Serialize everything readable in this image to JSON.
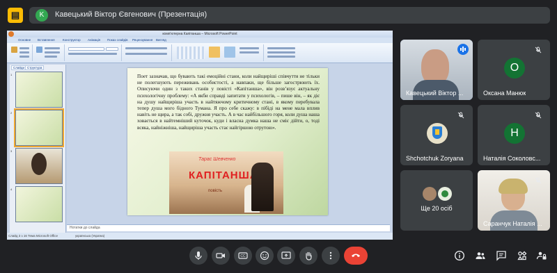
{
  "presentation_banner": {
    "avatar_letter": "K",
    "text": "Кавецький Віктор Євгенович (Презентація)"
  },
  "ppt": {
    "window_title": "комп'ютерна Капітанша – Microsoft PowerPoint",
    "tabs": [
      "Основне",
      "Вставлення",
      "Конструктор",
      "Анімація",
      "Показ слайдів",
      "Рецензування",
      "Вигляд"
    ],
    "panel_tabs": [
      "Слайди",
      "Структура"
    ],
    "slide_numbers": [
      "1",
      "2",
      "3",
      "4"
    ],
    "slide_text": "Поет зазначав, що бувають такі емоційні стани, коли найщиріші співчуття не тільки не полегшують переживань особистості, а навпаки, ще більше загострюють їх. Описуючи один з таких станів у повісті «Капітанша», він розв’язує актуальну психологічну проблему: «А якби справді запитати у психологів, – пише він, – як діє на душу найщиріша участь в найтяжчому критичному стані, в якому перебувала тепер душа мого бідного Туманa. Я про себе скажу: в пібіді на мене мала вплив навіть не щира, а так собі, дружня участь. А в час найбільшого горя, коли душа наша ховається в найтемніший куточок, куди і власна думка наша не сміє дійти, о, тоді всяка, найніжніша, найщиріша участь стає найгіршою отрутою».",
    "book_author": "Тарас Шевченко",
    "book_title": "КАПІТАНША",
    "book_subtitle": "повість",
    "notes_placeholder": "Нотатки до слайда",
    "status_left": "Слайд 3 з 16",
    "status_mid": "Тема Microsoft Office",
    "status_lang": "українська (Україна)"
  },
  "participants": [
    {
      "name": "Кавецький Віктор ...",
      "avatar": "",
      "color": "#6b7b8c",
      "speaking": true,
      "muted": false
    },
    {
      "name": "Оксана Манюк",
      "avatar": "О",
      "color": "#137333",
      "speaking": false,
      "muted": true
    },
    {
      "name": "Shchotchuk Zoryana",
      "avatar": "",
      "color": "#e8e1c8",
      "speaking": false,
      "muted": true
    },
    {
      "name": "Наталія Соколовс...",
      "avatar": "Н",
      "color": "#137333",
      "speaking": false,
      "muted": true
    },
    {
      "name": "Ще 20 осіб",
      "avatar": "",
      "color": "#3c4043",
      "speaking": false,
      "muted": false
    },
    {
      "name": "Саранчук Наталія ...",
      "avatar": "",
      "color": "#d9d4cc",
      "speaking": false,
      "muted": true
    }
  ],
  "controls": {
    "mic": "microphone-icon",
    "camera": "camera-icon",
    "captions": "closed-captions-icon",
    "emoji": "emoji-icon",
    "present": "present-screen-icon",
    "raise_hand": "raise-hand-icon",
    "more": "more-options-icon",
    "end": "end-call-icon",
    "captions_label": "CC"
  },
  "colors": {
    "background": "#202124",
    "tile": "#3c4043",
    "accent": "#8ab4f8",
    "end_call": "#ea4335",
    "presenting": "#fbbc04"
  }
}
